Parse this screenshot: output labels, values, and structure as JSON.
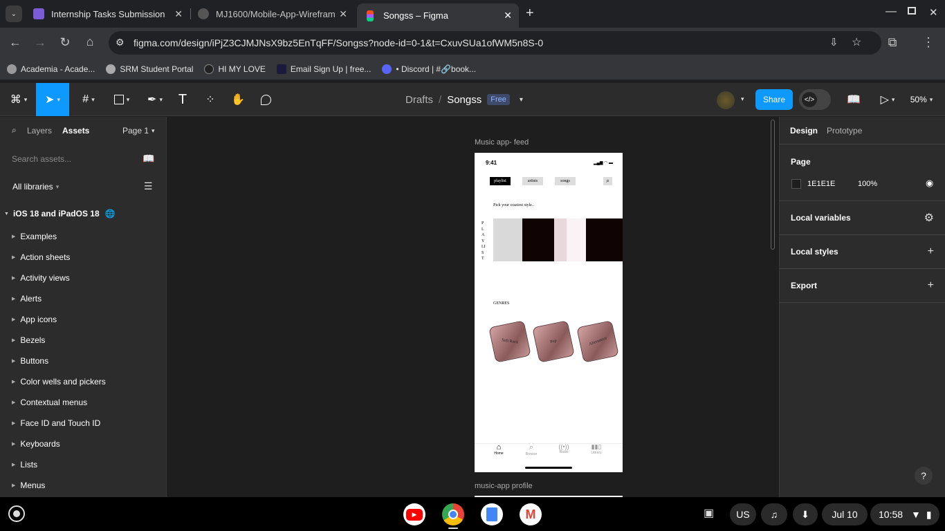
{
  "browser": {
    "tabs": [
      {
        "title": "Internship Tasks Submission",
        "active": false,
        "favicon_color": "#7b5cd6"
      },
      {
        "title": "MJ1600/Mobile-App-Wirefram",
        "active": false,
        "favicon_color": "#555555"
      },
      {
        "title": "Songss – Figma",
        "active": true,
        "favicon_color": "#f24e1e"
      }
    ],
    "url": "figma.com/design/iPjZ3CJMJNsX9bz5EnTqFF/Songss?node-id=0-1&t=CxuvSUa1ofWM5n8S-0",
    "bookmarks": [
      "Academia - Acade...",
      "SRM Student Portal",
      "HI MY LOVE",
      "Email Sign Up | free...",
      "• Discord | #🔗book..."
    ]
  },
  "figma": {
    "breadcrumb": {
      "folder": "Drafts",
      "file": "Songss",
      "plan": "Free"
    },
    "share_label": "Share",
    "zoom": "50%",
    "left": {
      "tab_layers": "Layers",
      "tab_assets": "Assets",
      "page": "Page 1",
      "search_placeholder": "Search assets...",
      "libraries": "All libraries",
      "library_name": "iOS 18 and iPadOS 18",
      "items": [
        "Examples",
        "Action sheets",
        "Activity views",
        "Alerts",
        "App icons",
        "Bezels",
        "Buttons",
        "Color wells and pickers",
        "Contextual menus",
        "Face ID and Touch ID",
        "Keyboards",
        "Lists",
        "Menus"
      ]
    },
    "canvas": {
      "frame_label": "Music app- feed",
      "frame2_label": "music-app profile",
      "status_time": "9:41",
      "tabs": [
        "playlist",
        "artists",
        "songs"
      ],
      "pick_text": "Pick your craziest style..",
      "playlist_vertical": "PLAYLIST",
      "genres_title": "GENRES",
      "genres": [
        "Soft Rock",
        "Pop",
        "Alternative"
      ],
      "nav": [
        "Home",
        "Browse",
        "Radio",
        "Library"
      ]
    },
    "right": {
      "tab_design": "Design",
      "tab_prototype": "Prototype",
      "page_heading": "Page",
      "page_color": "1E1E1E",
      "page_opacity": "100%",
      "local_variables": "Local variables",
      "local_styles": "Local styles",
      "export": "Export",
      "help": "?"
    }
  },
  "shelf": {
    "input": "US",
    "date": "Jul 10",
    "time": "10:58"
  }
}
